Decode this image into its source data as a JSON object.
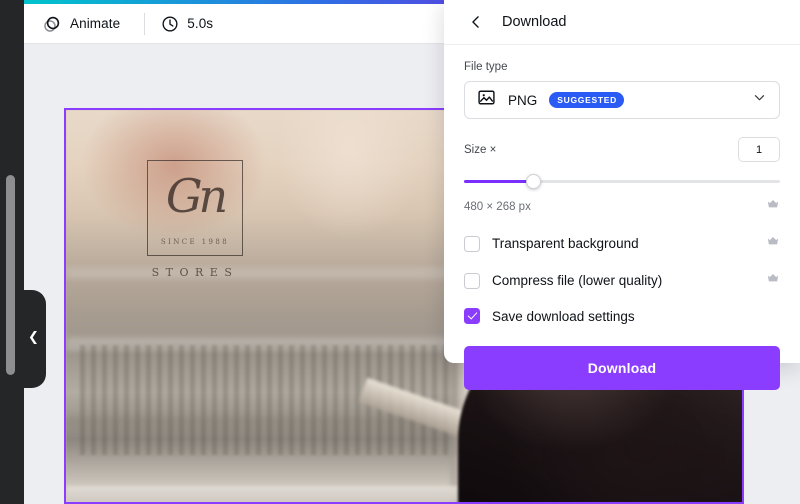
{
  "toolbar": {
    "animate_label": "Animate",
    "animate_icon": "stacked-circles-icon",
    "duration_label": "5.0s",
    "duration_icon": "clock-icon"
  },
  "sidebar": {
    "collapse_icon": "chevron-left-icon",
    "scrollbar": "vertical-scrollbar"
  },
  "canvas": {
    "logo": {
      "monogram": "Gn",
      "since_text": "SINCE 1988",
      "wordmark": "STORES"
    },
    "selection_color": "#8b3dff"
  },
  "panel": {
    "back_icon": "chevron-left-icon",
    "title": "Download",
    "file_type": {
      "label": "File type",
      "icon": "image-icon",
      "value": "PNG",
      "badge": "SUGGESTED",
      "expand_icon": "chevron-down-icon"
    },
    "size": {
      "label": "Size ×",
      "input_value": "1",
      "slider_percent": 22,
      "dimensions": "480 × 268 px",
      "crown_icon": "crown-icon"
    },
    "options": [
      {
        "label": "Transparent background",
        "checked": false,
        "crown_icon": "crown-icon"
      },
      {
        "label": "Compress file (lower quality)",
        "checked": false,
        "crown_icon": "crown-icon"
      },
      {
        "label": "Save download settings",
        "checked": true,
        "crown_icon": ""
      }
    ],
    "download_button": "Download"
  },
  "colors": {
    "accent_purple": "#8b3dff",
    "badge_blue": "#2b5bf5",
    "rail_dark": "#252627",
    "workspace_gray": "#edeef2"
  }
}
